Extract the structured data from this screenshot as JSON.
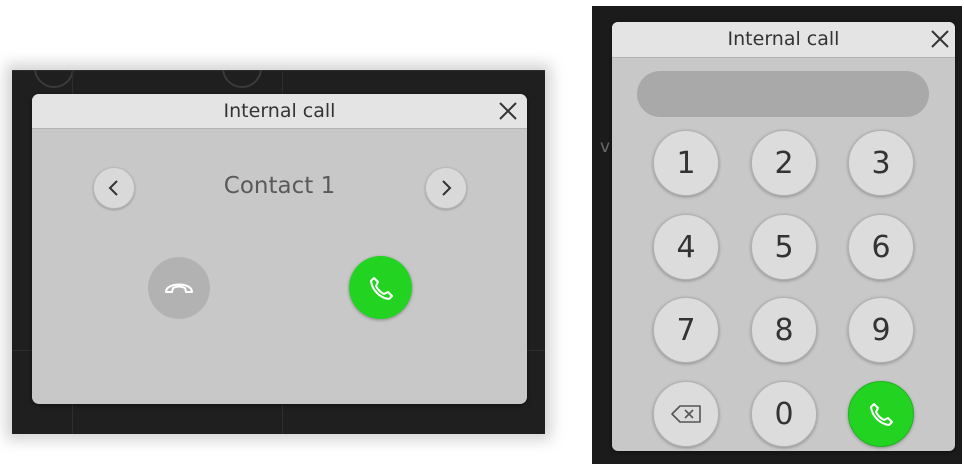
{
  "contact_dialog": {
    "title": "Internal call",
    "contact_name": "Contact 1"
  },
  "dialpad_dialog": {
    "title": "Internal call",
    "number_value": "",
    "keys": [
      "1",
      "2",
      "3",
      "4",
      "5",
      "6",
      "7",
      "8",
      "9",
      "0"
    ]
  },
  "background_fragment": "v",
  "colors": {
    "call_green": "#22d322",
    "hangup_gray": "#b2b2b2",
    "dialog_bg": "#c8c8c8",
    "titlebar_bg": "#e4e4e4"
  },
  "icons": {
    "close": "close-icon",
    "prev": "chevron-left-icon",
    "next": "chevron-right-icon",
    "hangup": "hang-up-icon",
    "call": "phone-icon",
    "backspace": "backspace-icon"
  }
}
